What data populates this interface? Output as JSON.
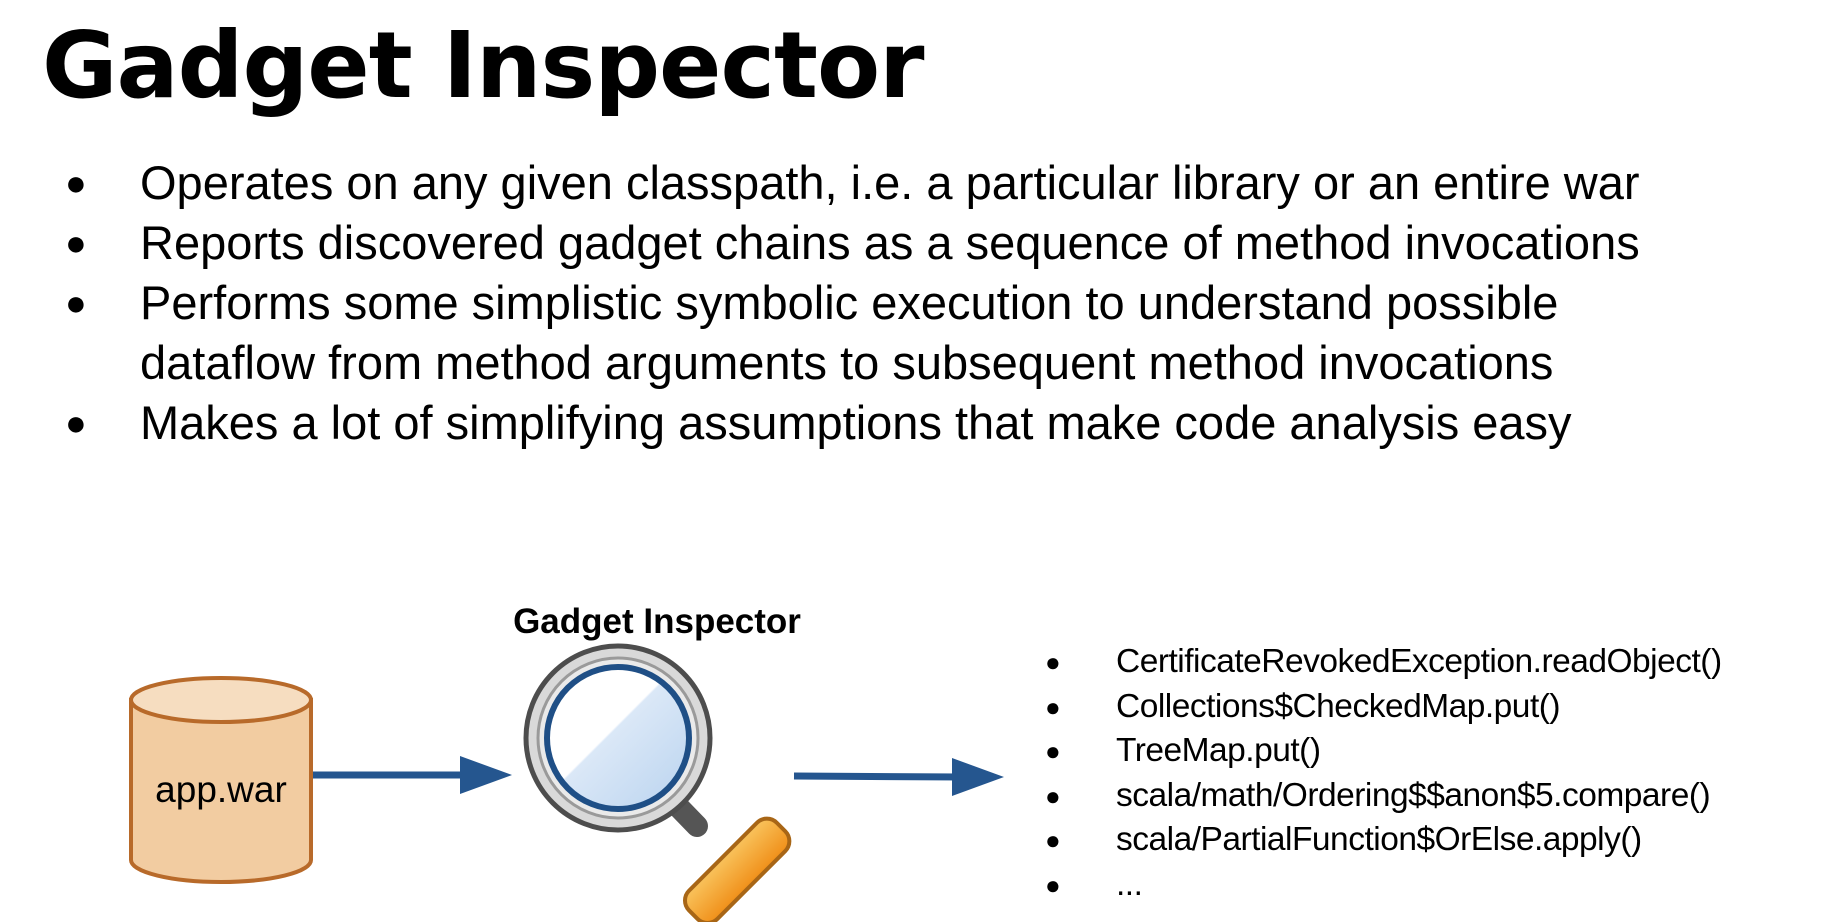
{
  "slide": {
    "title": "Gadget Inspector",
    "bullets": [
      "Operates on any given classpath, i.e. a particular library or an entire war",
      "Reports discovered gadget chains as a sequence of method invocations",
      "Performs some simplistic symbolic execution to understand possible dataflow from method arguments to subsequent method invocations",
      "Makes a lot of simplifying assumptions that make code analysis easy"
    ]
  },
  "diagram": {
    "input_label": "app.war",
    "tool_label": "Gadget Inspector",
    "input_icon": "database-cylinder-icon",
    "tool_icon": "magnifying-glass-icon",
    "output_chain": [
      "CertificateRevokedException.readObject()",
      "Collections$CheckedMap.put()",
      "TreeMap.put()",
      "scala/math/Ordering$$anon$5.compare()",
      "scala/PartialFunction$OrElse.apply()",
      "..."
    ],
    "colors": {
      "cylinder_fill": "#f2cca1",
      "cylinder_top": "#f6ddc0",
      "cylinder_stroke": "#b86a2a",
      "arrow": "#25568f",
      "lens_ring": "#1f4f86",
      "handle": "#f7a72e"
    }
  }
}
